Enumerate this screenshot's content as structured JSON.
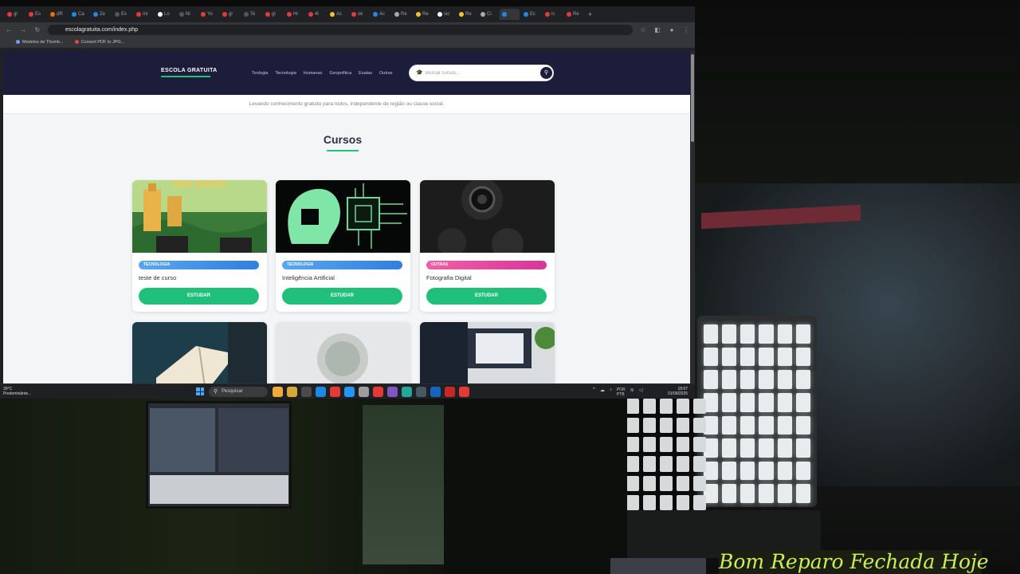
{
  "browser": {
    "tabs": [
      {
        "label": "gl",
        "color": "#e53935"
      },
      {
        "label": "Es",
        "color": "#e53935"
      },
      {
        "label": "dR",
        "color": "#ef6c00"
      },
      {
        "label": "Ca",
        "color": "#1e88e5"
      },
      {
        "label": "Ze",
        "color": "#1e88e5"
      },
      {
        "label": "Ex",
        "color": "#555"
      },
      {
        "label": "Ini",
        "color": "#e53935"
      },
      {
        "label": "Lo",
        "color": "#fff"
      },
      {
        "label": "Ni",
        "color": "#555"
      },
      {
        "label": "Yo",
        "color": "#e53935"
      },
      {
        "label": "gl",
        "color": "#e53935"
      },
      {
        "label": "Te",
        "color": "#555"
      },
      {
        "label": "gl",
        "color": "#e53935"
      },
      {
        "label": "Hr",
        "color": "#e53935"
      },
      {
        "label": "4l",
        "color": "#e53935"
      },
      {
        "label": "Ac",
        "color": "#fbc02d"
      },
      {
        "label": "ok",
        "color": "#e53935"
      },
      {
        "label": "Ac",
        "color": "#1e88e5"
      },
      {
        "label": "Re",
        "color": "#aaa"
      },
      {
        "label": "Re",
        "color": "#fbc02d"
      },
      {
        "label": "sic",
        "color": "#fff"
      },
      {
        "label": "Re",
        "color": "#fbc02d"
      },
      {
        "label": "Ci",
        "color": "#aaa"
      },
      {
        "label": "",
        "color": "#1e88e5",
        "active": true
      },
      {
        "label": "Ec",
        "color": "#1e88e5"
      },
      {
        "label": "ic",
        "color": "#e53935"
      },
      {
        "label": "Re",
        "color": "#e53935"
      }
    ],
    "new_tab": "+",
    "url": "escolagratuita.com/index.php",
    "bookmarks": [
      "Modelos de Thumb...",
      "Convert PDF to JPG..."
    ]
  },
  "site": {
    "logo": "ESCOLA GRATUITA",
    "menu": [
      "Teologia",
      "Tecnologia",
      "Humanas",
      "Geopolítica",
      "Exatas",
      "Outras"
    ],
    "search": {
      "placeholder": "Buscar cursos..."
    },
    "tagline": "Levando conhecimento gratuito para todos, independente de região ou classe social.",
    "heading": "Cursos",
    "courses": [
      {
        "category": "TECNOLOGIA",
        "title": "teste de curso",
        "button": "ESTUDAR",
        "image_caption": "300 ANOS",
        "badge_color": "#3a8ee6"
      },
      {
        "category": "TECNOLOGIA",
        "title": "Inteligência Artificial",
        "button": "ESTUDAR",
        "badge_color": "#3a8ee6"
      },
      {
        "category": "OUTRAS",
        "title": "Fotografia Digital",
        "button": "ESTUDAR",
        "badge_color": "#e0409a"
      }
    ],
    "accent": "#20c07a",
    "nav_color": "#1b1d3a"
  },
  "taskbar": {
    "weather_temp": "39°C",
    "weather_desc": "Predominânte...",
    "search_label": "Pesquisar",
    "lang": "POR",
    "lang2": "PTB",
    "time": "18:07",
    "date": "01/09/2025",
    "app_icon_colors": [
      "#f2a93b",
      "#d7a93a",
      "#4a4a4a",
      "#1e88e5",
      "#e53935",
      "#2196f3",
      "#9e9e9e",
      "#e53935",
      "#7e57c2",
      "#26a69a",
      "#455a64",
      "#1565c0",
      "#c62828",
      "#e53935"
    ]
  },
  "overlay": {
    "text": "Bom Reparo Fechada Hoje"
  }
}
